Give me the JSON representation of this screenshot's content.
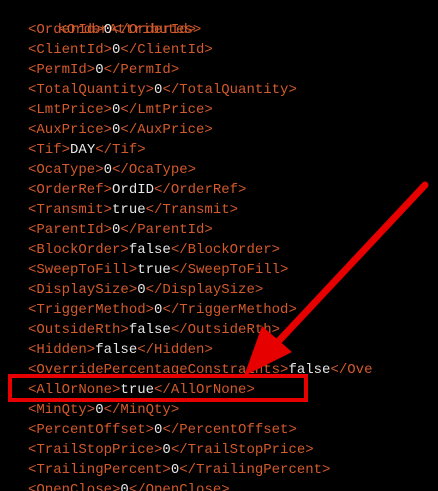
{
  "colors": {
    "background": "#000000",
    "tag": "#d35a2b",
    "value": "#e6e6e6",
    "annotation": "#e60000"
  },
  "xml": {
    "root_open": "<OrderAttributes>",
    "lines": [
      {
        "open": "<OrderId>",
        "value": "0",
        "close": "</OrderId>"
      },
      {
        "open": "<ClientId>",
        "value": "0",
        "close": "</ClientId>"
      },
      {
        "open": "<PermId>",
        "value": "0",
        "close": "</PermId>"
      },
      {
        "open": "<TotalQuantity>",
        "value": "0",
        "close": "</TotalQuantity>"
      },
      {
        "open": "<LmtPrice>",
        "value": "0",
        "close": "</LmtPrice>"
      },
      {
        "open": "<AuxPrice>",
        "value": "0",
        "close": "</AuxPrice>"
      },
      {
        "open": "<Tif>",
        "value": "DAY",
        "close": "</Tif>"
      },
      {
        "open": "<OcaType>",
        "value": "0",
        "close": "</OcaType>"
      },
      {
        "open": "<OrderRef>",
        "value": "OrdID",
        "close": "</OrderRef>"
      },
      {
        "open": "<Transmit>",
        "value": "true",
        "close": "</Transmit>"
      },
      {
        "open": "<ParentId>",
        "value": "0",
        "close": "</ParentId>"
      },
      {
        "open": "<BlockOrder>",
        "value": "false",
        "close": "</BlockOrder>"
      },
      {
        "open": "<SweepToFill>",
        "value": "true",
        "close": "</SweepToFill>"
      },
      {
        "open": "<DisplaySize>",
        "value": "0",
        "close": "</DisplaySize>"
      },
      {
        "open": "<TriggerMethod>",
        "value": "0",
        "close": "</TriggerMethod>"
      },
      {
        "open": "<OutsideRth>",
        "value": "false",
        "close": "</OutsideRth>"
      },
      {
        "open": "<Hidden>",
        "value": "false",
        "close": "</Hidden>"
      },
      {
        "open": "<OverridePercentageConstraints>",
        "value": "false",
        "close": "</Ove"
      },
      {
        "open": "<AllOrNone>",
        "value": "true",
        "close": "</AllOrNone>"
      },
      {
        "open": "<MinQty>",
        "value": "0",
        "close": "</MinQty>"
      },
      {
        "open": "<PercentOffset>",
        "value": "0",
        "close": "</PercentOffset>"
      },
      {
        "open": "<TrailStopPrice>",
        "value": "0",
        "close": "</TrailStopPrice>"
      },
      {
        "open": "<TrailingPercent>",
        "value": "0",
        "close": "</TrailingPercent>"
      },
      {
        "open": "<OpenClose>",
        "value": "0",
        "close": "</OpenClose>"
      }
    ]
  }
}
